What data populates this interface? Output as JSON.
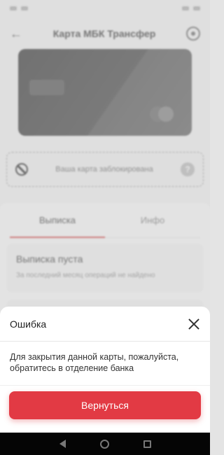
{
  "status_bar": {
    "time": ""
  },
  "header": {
    "title": "Карта МБК Трансфер"
  },
  "card_image": {
    "brand_text": ""
  },
  "blocked_banner": {
    "text": "Ваша карта заблокирована",
    "help": "?"
  },
  "tabs": [
    {
      "label": "Выписка",
      "active": true
    },
    {
      "label": "Инфо",
      "active": false
    }
  ],
  "statement": {
    "title": "Выписка пуста",
    "subtitle": "За последний месяц операций не найдено"
  },
  "modal": {
    "title": "Ошибка",
    "message": "Для закрытия данной карты, пожалуйста, обратитесь в отделение банка",
    "button": "Вернуться"
  },
  "colors": {
    "accent": "#e23a44",
    "tab_underline": "#d24040",
    "nav_bar": "#050505"
  },
  "icons": [
    "back-arrow-icon",
    "settings-icon",
    "block-icon",
    "help-icon",
    "close-icon",
    "nav-back-icon",
    "nav-home-icon",
    "nav-recent-icon"
  ]
}
